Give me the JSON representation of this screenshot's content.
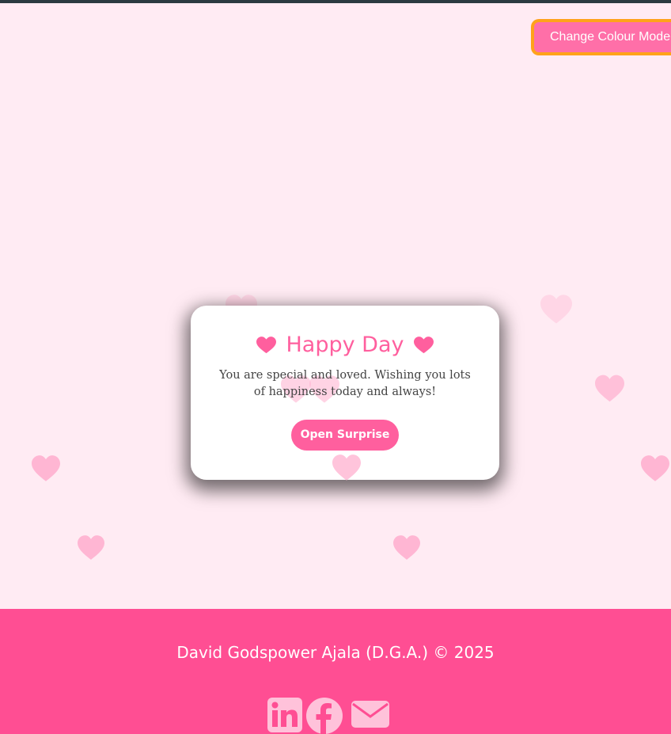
{
  "header": {
    "mode_button_label": "Change Colour Mode"
  },
  "card": {
    "title": "Happy Day",
    "title_icon": "heart-icon",
    "message": "You are special and loved. Wishing you lots of happiness today and always!",
    "button_label": "Open Surprise"
  },
  "footer": {
    "credit": "David Godspower Ajala (D.G.A.) © 2025",
    "social_icons": [
      "linkedin-icon",
      "facebook-icon",
      "envelope-icon"
    ]
  },
  "colors": {
    "background": "#ffebf3",
    "accent": "#ff5f9e",
    "footer": "#ff4e93",
    "button_border": "#ffa21a",
    "floating_heart": "#ffb6d3"
  }
}
